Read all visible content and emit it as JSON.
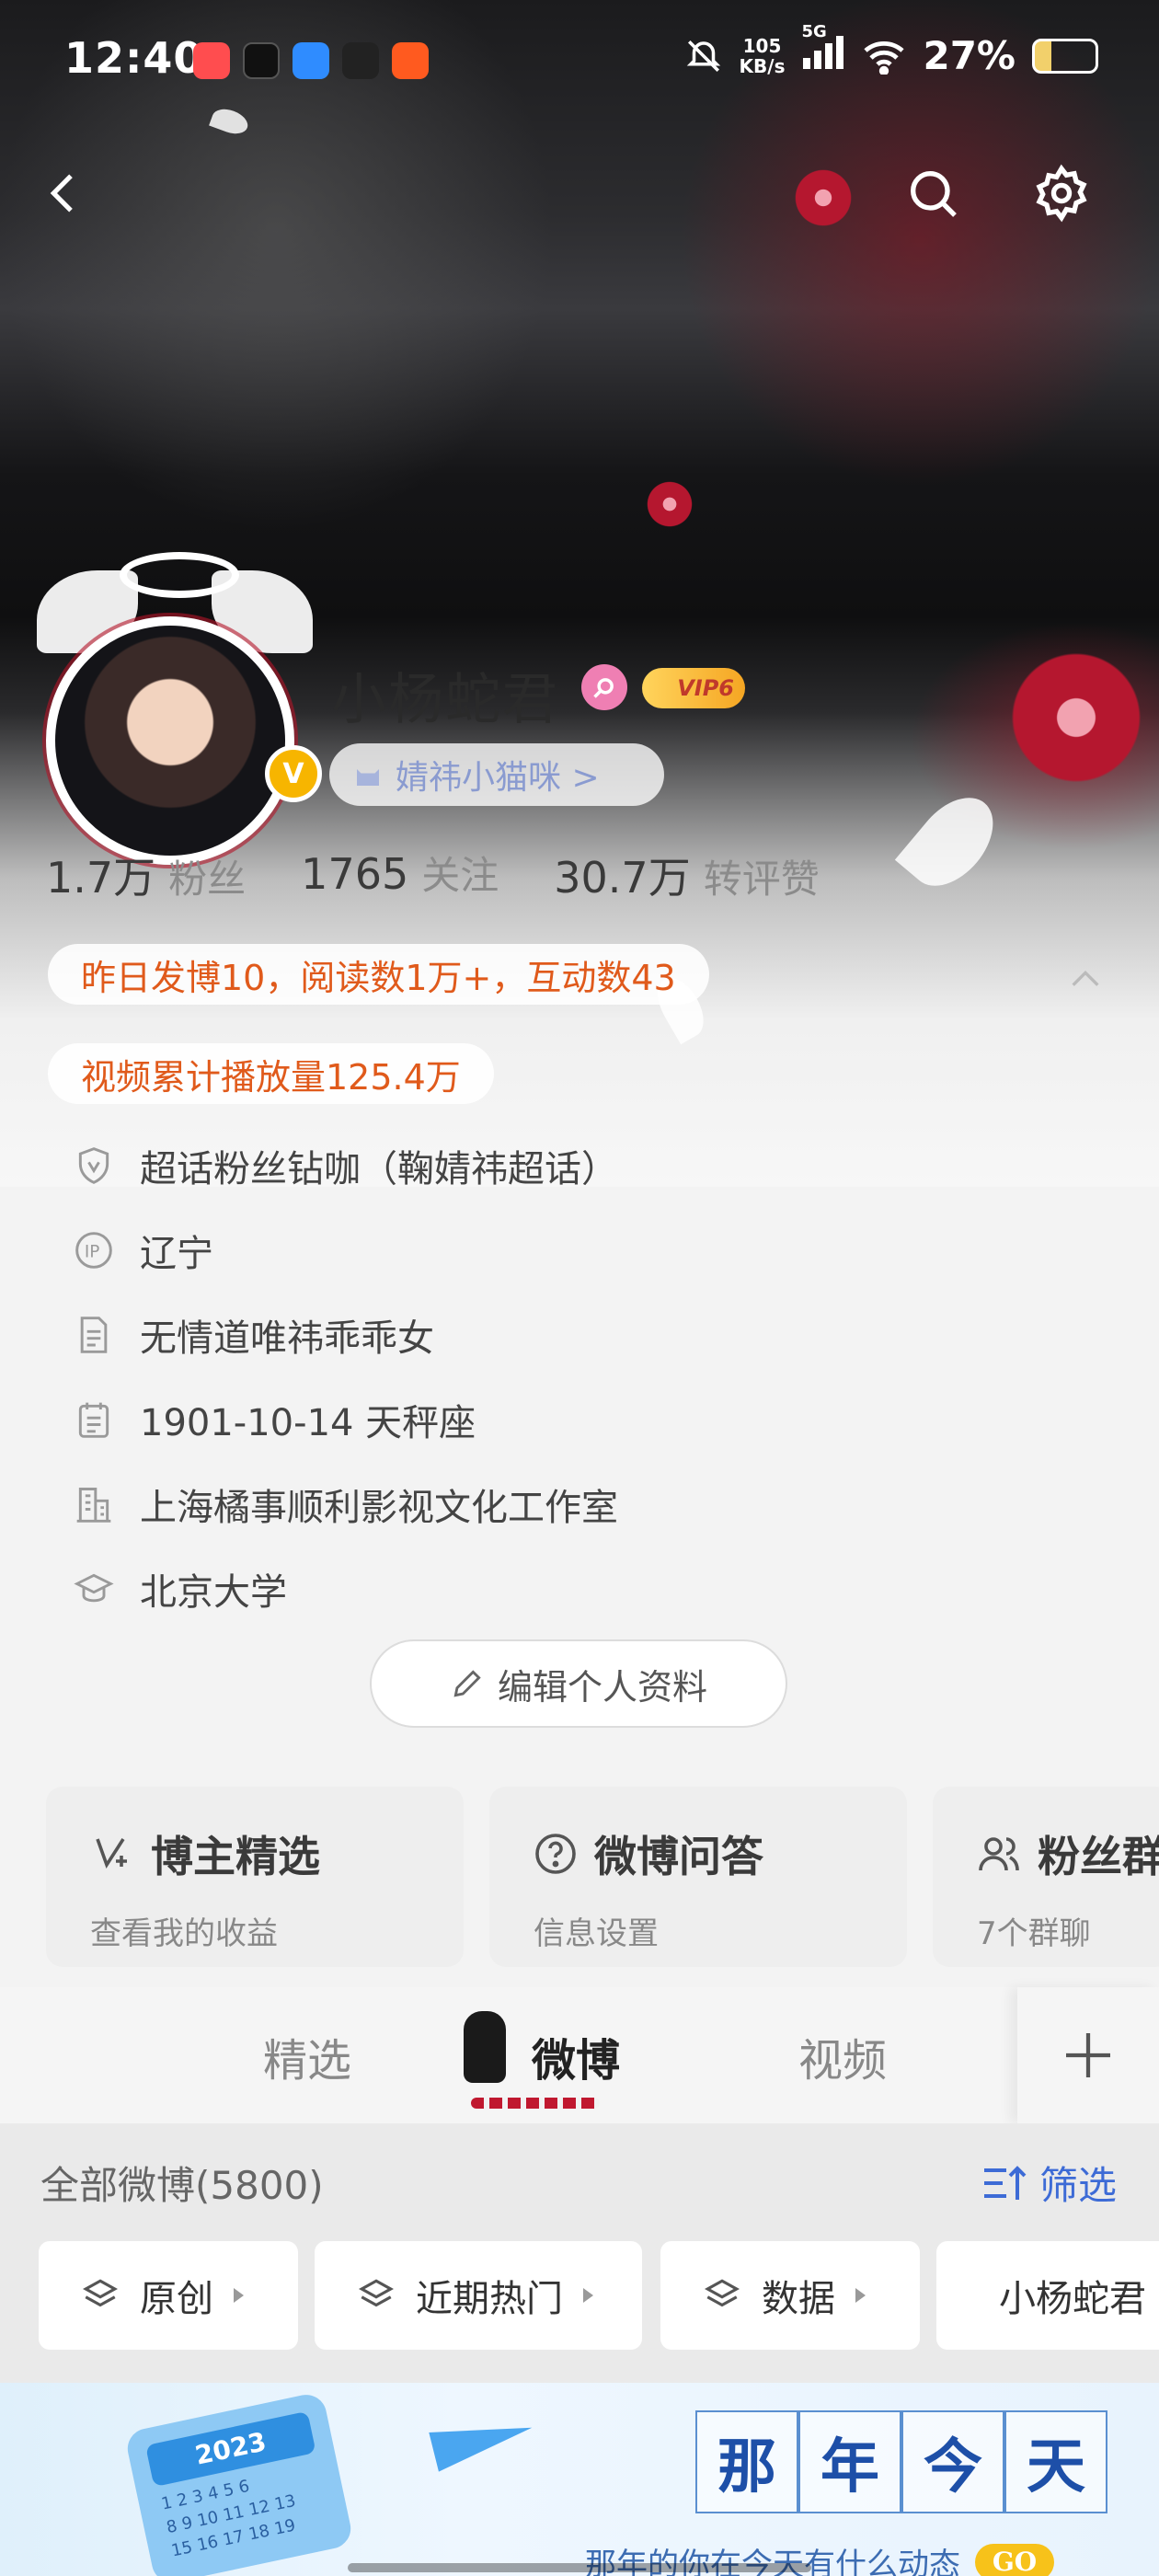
{
  "status_bar": {
    "time": "12:40",
    "speed_value": "105",
    "speed_unit": "KB/s",
    "network": "5G",
    "battery": "27%",
    "battery_level": 0.27
  },
  "nav": {
    "back_icon": "chevron-left-icon",
    "search_icon": "search-icon",
    "settings_icon": "gear-icon"
  },
  "profile": {
    "name": "小杨蛇君",
    "vip_label": "VIP6",
    "fan_group_label": "婧祎小猫咪 >",
    "verified_mark": "V",
    "stats": [
      {
        "value": "1.7万",
        "label": "粉丝"
      },
      {
        "value": "1765",
        "label": "关注"
      },
      {
        "value": "30.7万",
        "label": "转评赞"
      }
    ],
    "highlights": [
      "昨日发博10，阅读数1万+，互动数43",
      "视频累计播放量125.4万"
    ],
    "info": [
      {
        "icon": "shield-icon",
        "text": "超话粉丝钻咖（鞠婧祎超话）"
      },
      {
        "icon": "ip-icon",
        "text": "辽宁"
      },
      {
        "icon": "document-icon",
        "text": "无情道唯祎乖乖女"
      },
      {
        "icon": "calendar-icon",
        "text": "1901-10-14 天秤座"
      },
      {
        "icon": "building-icon",
        "text": "上海橘事顺利影视文化工作室"
      },
      {
        "icon": "graduation-cap-icon",
        "text": "北京大学"
      }
    ],
    "edit_button": "编辑个人资料"
  },
  "cards": [
    {
      "title": "博主精选",
      "subtitle": "查看我的收益",
      "icon": "edit-star-icon"
    },
    {
      "title": "微博问答",
      "subtitle": "信息设置",
      "icon": "question-icon"
    },
    {
      "title": "粉丝群",
      "subtitle": "7个群聊",
      "icon": "group-icon"
    }
  ],
  "tabs": [
    {
      "label": "精选",
      "active": false
    },
    {
      "label": "微博",
      "active": true
    },
    {
      "label": "视频",
      "active": false
    }
  ],
  "feed": {
    "all_label": "全部微博(5800)",
    "filter_label": "筛选",
    "chips": [
      "原创",
      "近期热门",
      "数据",
      "小杨蛇君"
    ]
  },
  "banner": {
    "calendar_year": "2023",
    "title_chars": [
      "那",
      "年",
      "今",
      "天"
    ],
    "subtitle": "那年的你在今天有什么动态",
    "go_label": "GO"
  },
  "colors": {
    "accent_blue": "#3d6bd6",
    "highlight_orange": "#e05a1b",
    "vip_gold": "#f5a623"
  }
}
